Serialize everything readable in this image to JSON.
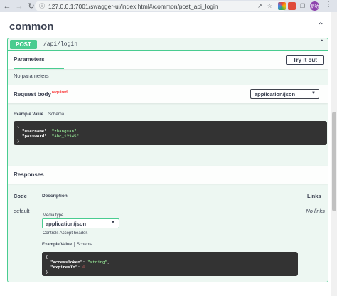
{
  "browser": {
    "url": "127.0.0.1:7001/swagger-ui/index.html#/common/post_api_login",
    "back_icon": "arrow-left-icon",
    "forward_icon": "arrow-right-icon",
    "reload_icon": "reload-icon",
    "info_icon": "info-icon",
    "avatar_text": "新功"
  },
  "tag": {
    "title": "common"
  },
  "operation": {
    "method": "POST",
    "path": "/api/login",
    "parameters": {
      "tab_label": "Parameters",
      "try_button": "Try it out",
      "empty_text": "No parameters"
    },
    "request_body": {
      "label": "Request body",
      "required_label": "required",
      "content_type": "application/json",
      "example_tab": "Example Value",
      "schema_tab": "Schema",
      "example": {
        "username": "zhangsan",
        "password": "Abc_12345"
      }
    },
    "responses": {
      "title": "Responses",
      "columns": {
        "code": "Code",
        "description": "Description",
        "links": "Links"
      },
      "rows": [
        {
          "code": "default",
          "media_type_label": "Media type",
          "media_type": "application/json",
          "controls_text": "Controls Accept header.",
          "example_tab": "Example Value",
          "schema_tab": "Schema",
          "example": {
            "accessToken": "string",
            "expiresIn": 0
          },
          "links": "No links"
        }
      ]
    }
  },
  "colors": {
    "post": "#49cc90",
    "opblock_bg": "#edf7f2",
    "code_bg": "#333333",
    "required": "#f93e3e"
  }
}
